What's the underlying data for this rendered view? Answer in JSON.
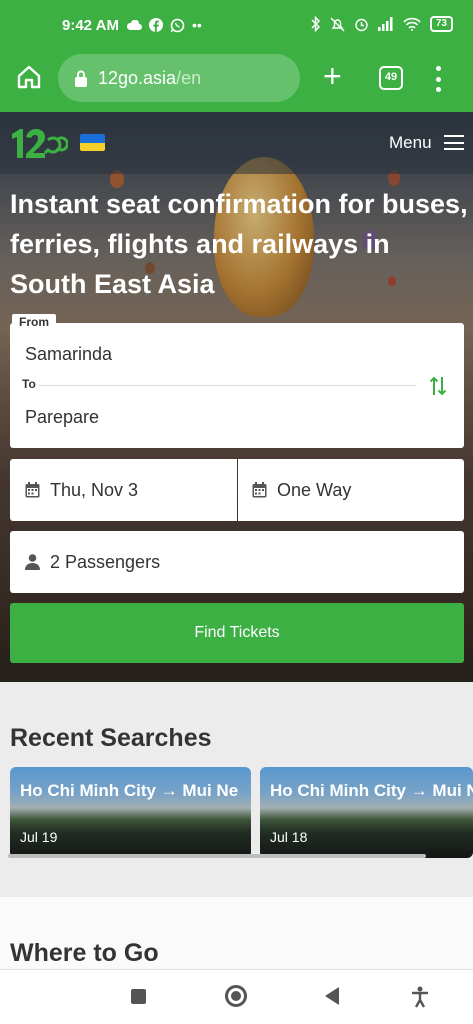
{
  "status_bar": {
    "time": "9:42 AM",
    "battery": "73",
    "left_icons": [
      "cloud-icon",
      "facebook-icon",
      "whatsapp-icon",
      "more-dots-icon"
    ],
    "right_icons": [
      "bluetooth-icon",
      "mute-icon",
      "alarm-icon",
      "signal-icon",
      "wifi-icon",
      "battery-icon"
    ]
  },
  "browser": {
    "url_domain": "12go.asia",
    "url_path": "/en",
    "tab_count": "49"
  },
  "site": {
    "menu_label": "Menu",
    "headline": "Instant seat confirmation for buses, ferries, flights and railways in South East Asia"
  },
  "search_form": {
    "from_label": "From",
    "from_value": "Samarinda",
    "to_label": "To",
    "to_value": "Parepare",
    "date_value": "Thu, Nov 3",
    "trip_type_value": "One Way",
    "passengers_value": "2 Passengers",
    "submit_label": "Find Tickets"
  },
  "recent_searches": {
    "title": "Recent Searches",
    "items": [
      {
        "route": "Ho Chi Minh City → Mui Ne",
        "date": "Jul 19"
      },
      {
        "route": "Ho Chi Minh City → Mui Ne",
        "date": "Jul 18"
      }
    ]
  },
  "where_to_go": {
    "title": "Where to Go"
  },
  "colors": {
    "brand_green": "#3cb043",
    "flag_blue": "#1a6fd8",
    "flag_yellow": "#f6cf2a"
  }
}
